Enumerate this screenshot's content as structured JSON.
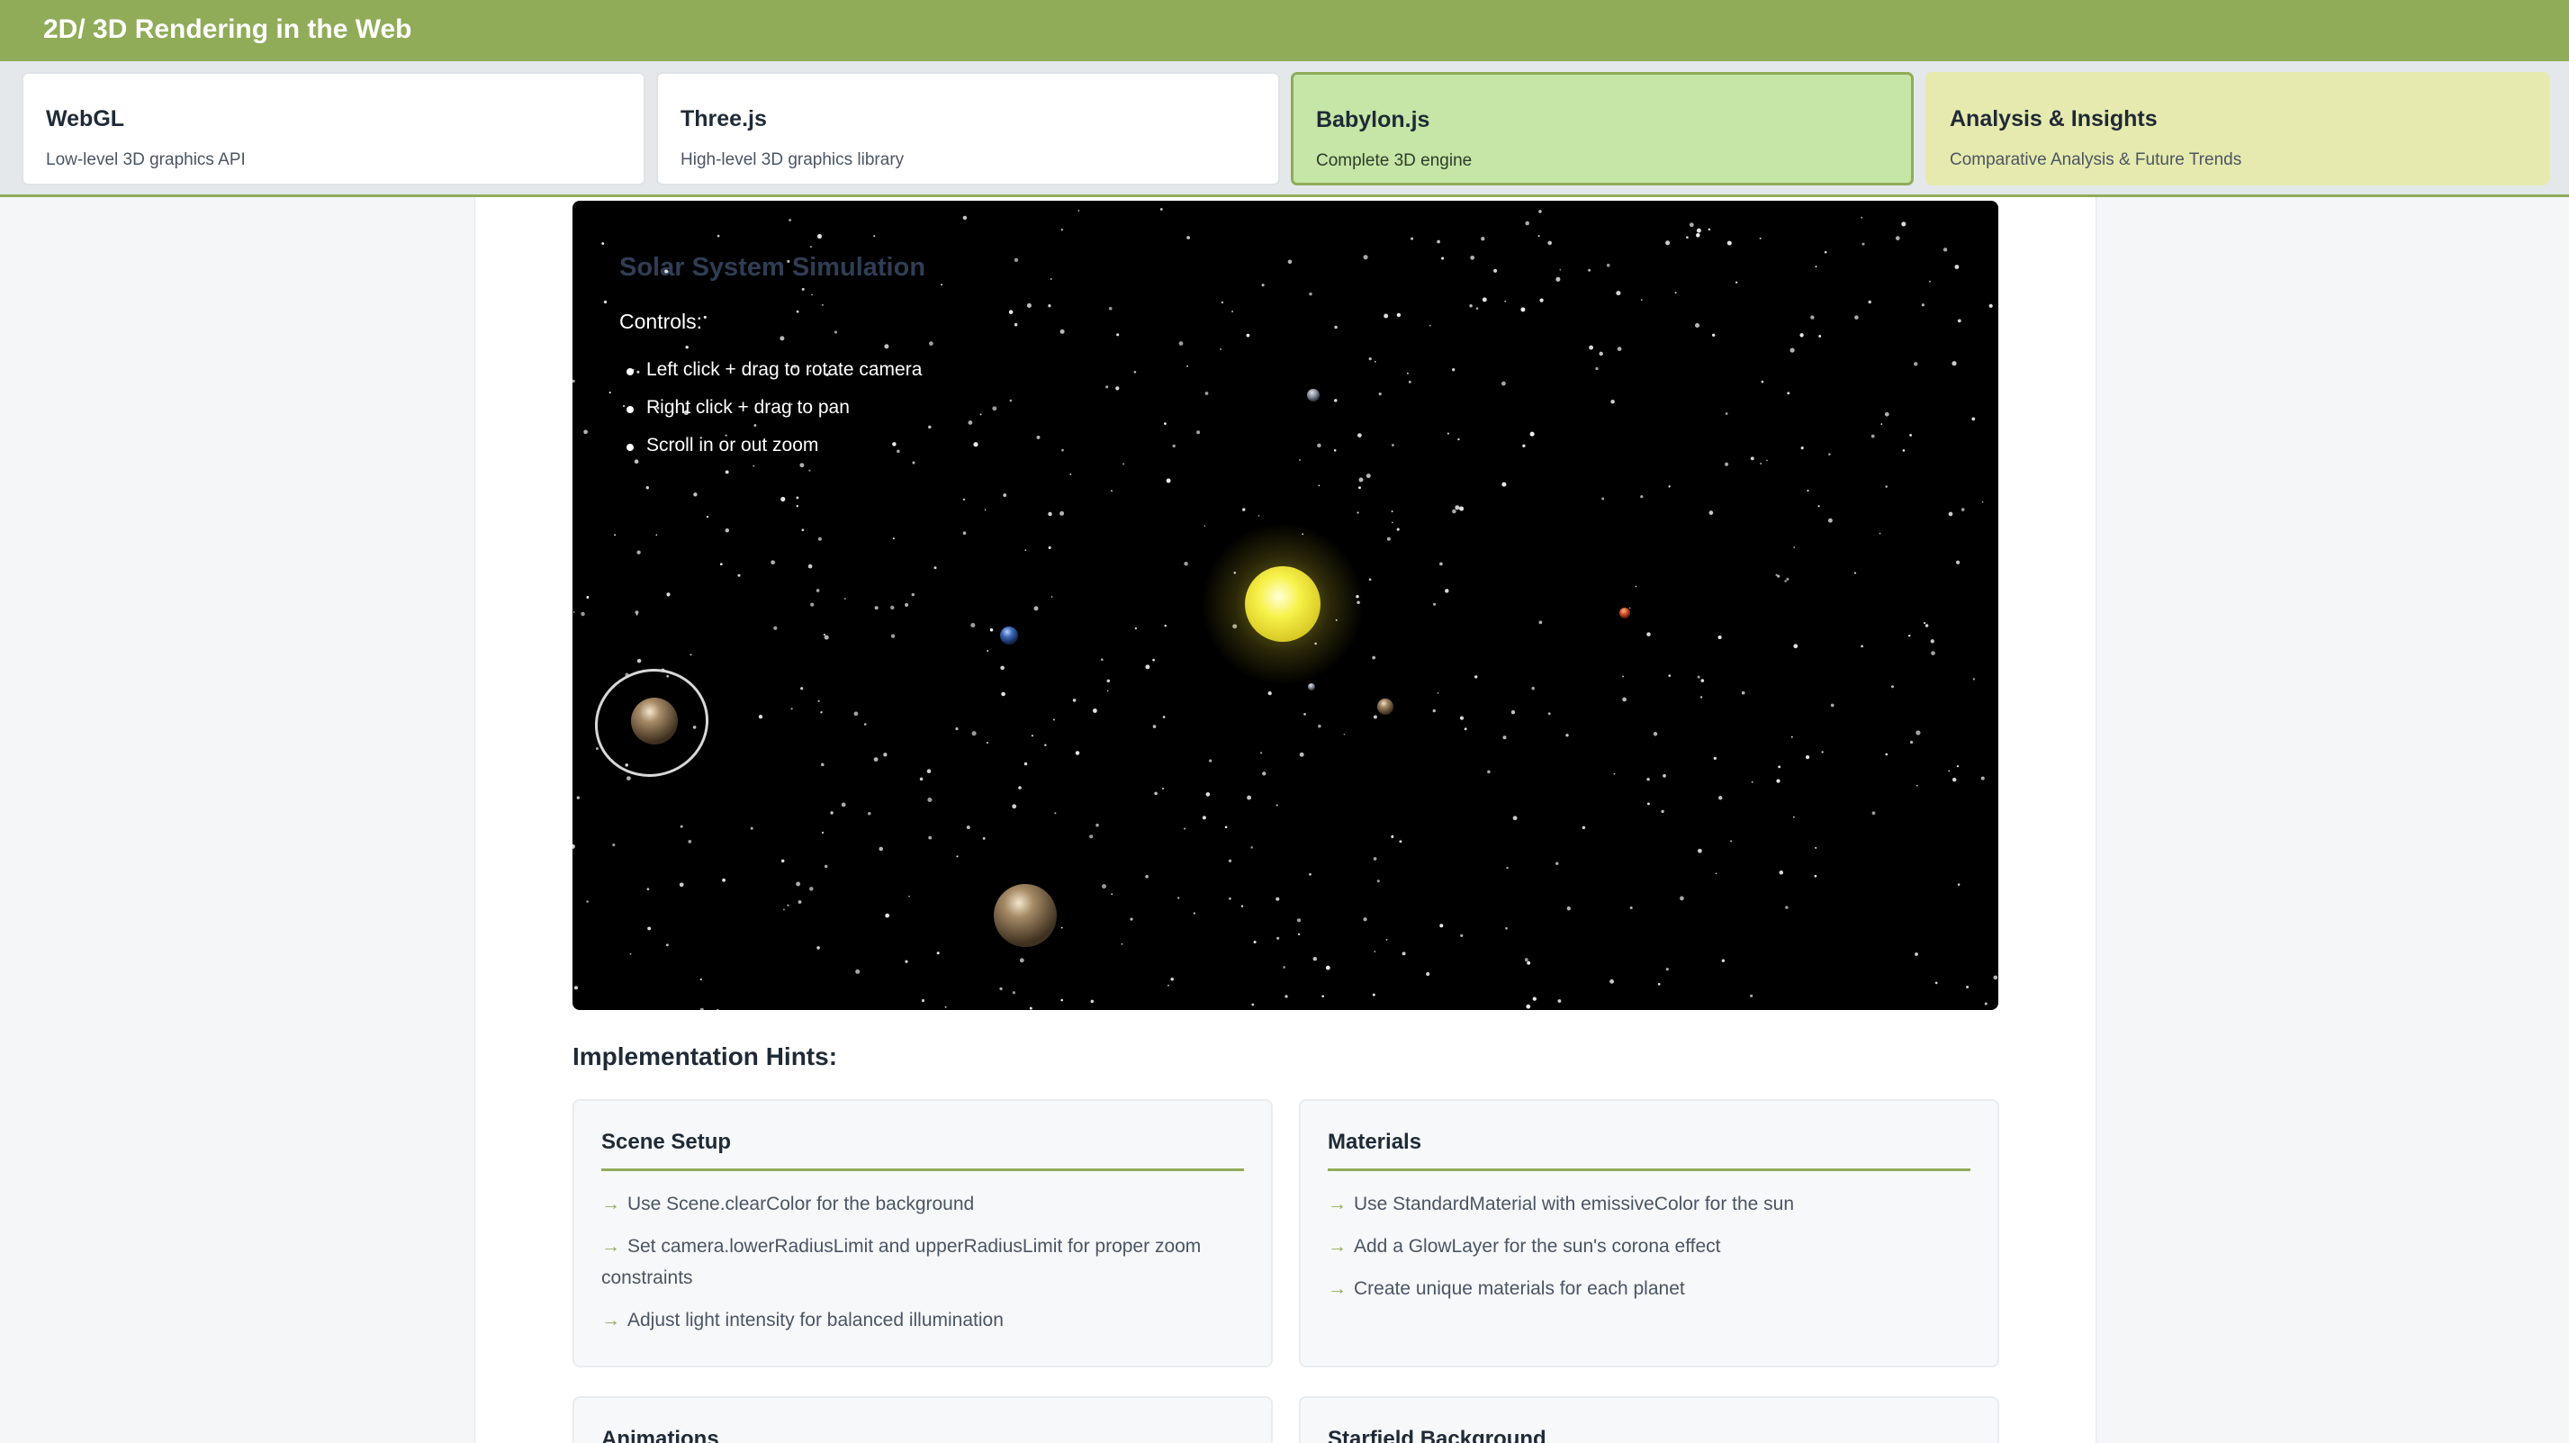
{
  "header": {
    "title": "2D/ 3D Rendering in the Web"
  },
  "tabs": [
    {
      "title": "WebGL",
      "subtitle": "Low-level 3D graphics API"
    },
    {
      "title": "Three.js",
      "subtitle": "High-level 3D graphics library"
    },
    {
      "title": "Babylon.js",
      "subtitle": "Complete 3D engine"
    },
    {
      "title": "Analysis & Insights",
      "subtitle": "Comparative Analysis & Future Trends"
    }
  ],
  "simulation": {
    "title": "Solar System Simulation",
    "controls_label": "Controls:",
    "controls": [
      "Left click + drag to rotate camera",
      "Right click + drag to pan",
      "Scroll in or out zoom"
    ]
  },
  "hints": {
    "title": "Implementation Hints:",
    "cards": [
      {
        "title": "Scene Setup",
        "items": [
          "Use Scene.clearColor for the background",
          "Set camera.lowerRadiusLimit and upperRadiusLimit for proper zoom constraints",
          "Adjust light intensity for balanced illumination"
        ]
      },
      {
        "title": "Materials",
        "items": [
          "Use StandardMaterial with emissiveColor for the sun",
          "Add a GlowLayer for the sun's corona effect",
          "Create unique materials for each planet"
        ]
      },
      {
        "title": "Animations"
      },
      {
        "title": "Starfield Background"
      }
    ],
    "arrow": "→"
  },
  "colors": {
    "accent": "#90ac59",
    "active_tab": "#c5e6a6",
    "insights_tab": "#e6eaae",
    "viewport_bg": "#000000",
    "sun": "#f5f040"
  },
  "icons": {
    "hint_bullet": "arrow-right-icon"
  }
}
